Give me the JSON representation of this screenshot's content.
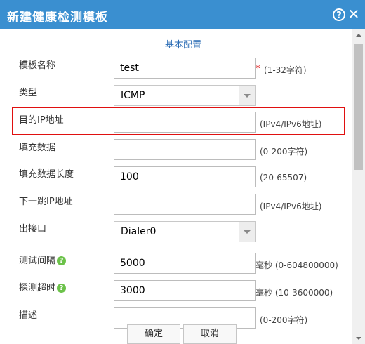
{
  "dialog": {
    "title": "新建健康检测模板",
    "help_icon": "?",
    "close_icon": "✕"
  },
  "section": {
    "title": "基本配置"
  },
  "form": {
    "template_name": {
      "label": "模板名称",
      "value": "test",
      "required_mark": "*",
      "hint": "(1-32字符)"
    },
    "type": {
      "label": "类型",
      "selected": "ICMP"
    },
    "dest_ip": {
      "label": "目的IP地址",
      "value": "",
      "hint": "(IPv4/IPv6地址)"
    },
    "fill_data": {
      "label": "填充数据",
      "value": "",
      "hint": "(0-200字符)"
    },
    "fill_data_length": {
      "label": "填充数据长度",
      "value": "100",
      "hint": "(20-65507)"
    },
    "next_hop_ip": {
      "label": "下一跳IP地址",
      "value": "",
      "hint": "(IPv4/IPv6地址)"
    },
    "outbound_interface": {
      "label": "出接口",
      "selected": "Dialer0"
    },
    "test_interval": {
      "label": "测试间隔",
      "value": "5000",
      "hint": "毫秒 (0-604800000)"
    },
    "probe_timeout": {
      "label": "探测超时",
      "value": "3000",
      "hint": "毫秒 (10-3600000)"
    },
    "description": {
      "label": "描述",
      "value": "",
      "hint": "(0-200字符)"
    }
  },
  "buttons": {
    "ok": "确定",
    "cancel": "取消"
  },
  "colors": {
    "titlebar": "#3a8fd0",
    "highlight": "#e01010",
    "help_green": "#6cc24a",
    "section_title": "#2c6db5"
  }
}
